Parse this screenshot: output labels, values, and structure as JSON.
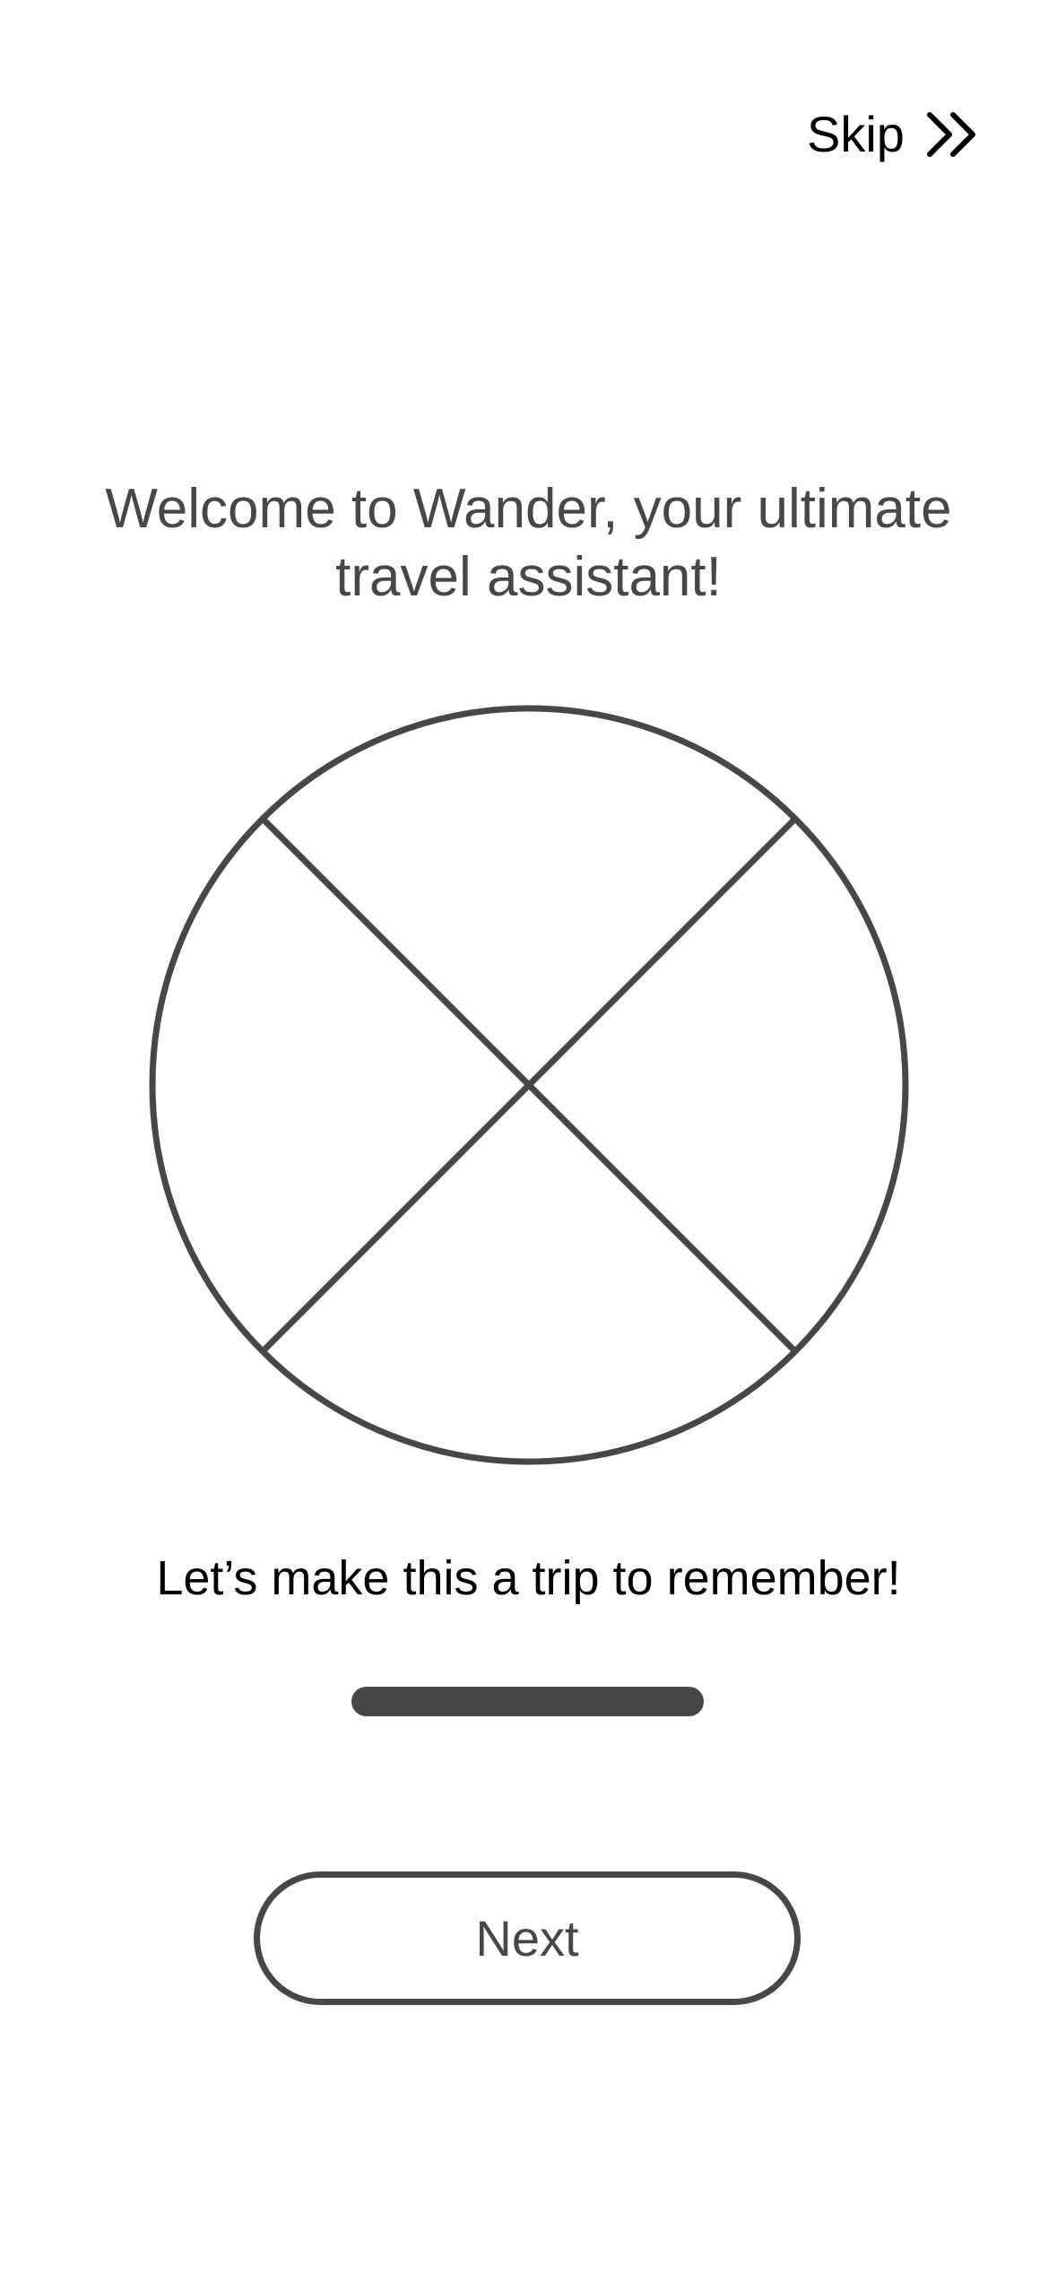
{
  "header": {
    "skip_label": "Skip",
    "skip_icon": "double-chevron-right-icon"
  },
  "onboarding": {
    "title": "Welcome to Wander, your ultimate travel assistant!",
    "image_placeholder": "image-placeholder-icon",
    "tagline": "Let’s make this a trip to remember!",
    "next_label": "Next"
  },
  "colors": {
    "text_primary": "#000000",
    "text_secondary": "#474747",
    "stroke": "#474747",
    "background": "#ffffff"
  }
}
